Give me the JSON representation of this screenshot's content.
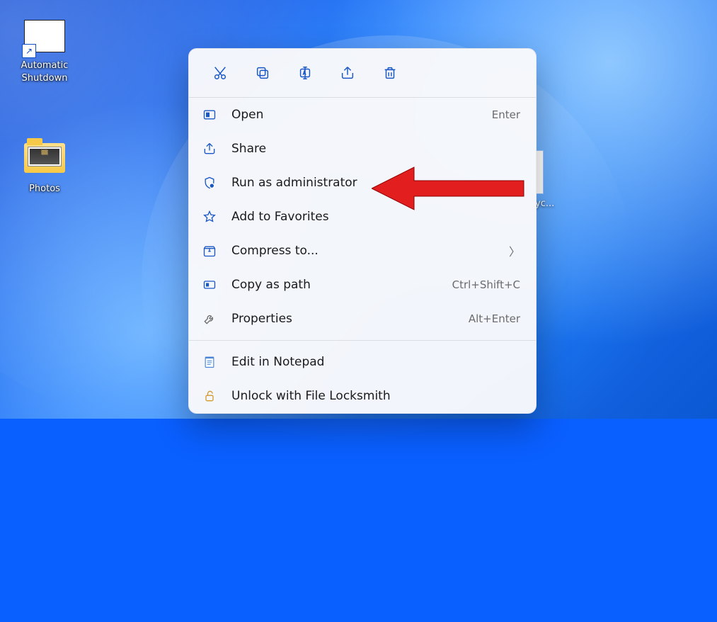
{
  "desktop": {
    "icons": {
      "automatic_shutdown": {
        "label": "Automatic Shutdown"
      },
      "photos": {
        "label": "Photos"
      },
      "partial": {
        "label": "yc..."
      }
    }
  },
  "context_menu": {
    "toolbar": {
      "cut": "cut-icon",
      "copy": "copy-icon",
      "rename": "rename-icon",
      "share": "share-icon",
      "delete": "delete-icon"
    },
    "items": [
      {
        "id": "open",
        "label": "Open",
        "accel": "Enter",
        "icon": "open-icon"
      },
      {
        "id": "share",
        "label": "Share",
        "accel": "",
        "icon": "share-icon"
      },
      {
        "id": "run-admin",
        "label": "Run as administrator",
        "accel": "",
        "icon": "shield-icon"
      },
      {
        "id": "add-favorites",
        "label": "Add to Favorites",
        "accel": "",
        "icon": "star-icon"
      },
      {
        "id": "compress",
        "label": "Compress to...",
        "accel": "",
        "icon": "zip-icon",
        "submenu": true
      },
      {
        "id": "copy-path",
        "label": "Copy as path",
        "accel": "Ctrl+Shift+C",
        "icon": "copy-path-icon"
      },
      {
        "id": "properties",
        "label": "Properties",
        "accel": "Alt+Enter",
        "icon": "wrench-icon"
      }
    ],
    "extra": [
      {
        "id": "edit-notepad",
        "label": "Edit in Notepad",
        "icon": "notepad-icon"
      },
      {
        "id": "unlock-locksmith",
        "label": "Unlock with File Locksmith",
        "icon": "lock-open-icon"
      }
    ]
  }
}
